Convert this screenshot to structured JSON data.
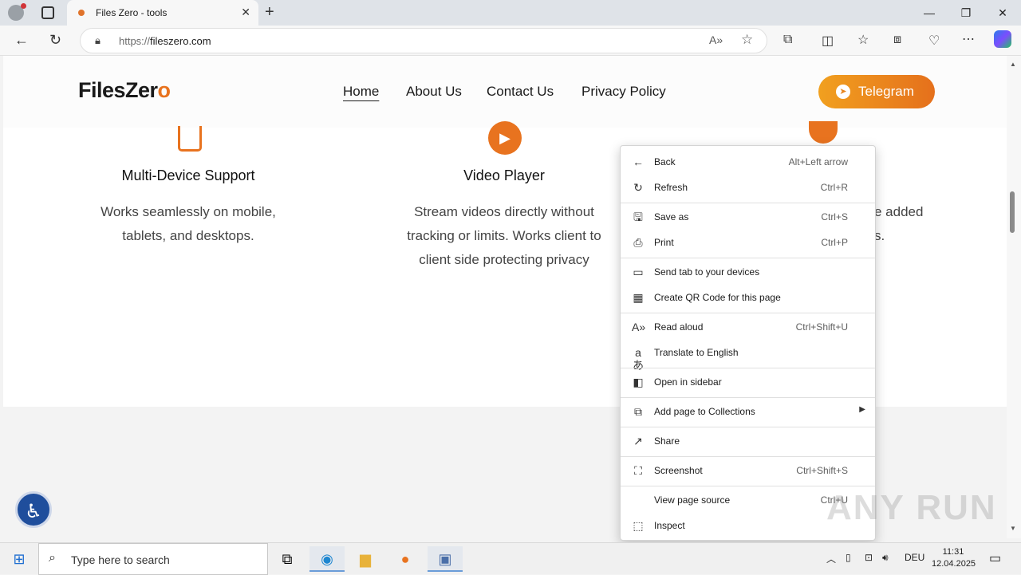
{
  "browser": {
    "tab_title": "Files Zero - tools",
    "url_prefix": "https://",
    "url_host": "fileszero.com"
  },
  "site": {
    "logo_main": "FilesZer",
    "logo_end": "o",
    "nav": [
      "Home",
      "About Us",
      "Contact Us",
      "Privacy Policy"
    ],
    "telegram_label": "Telegram"
  },
  "features": [
    {
      "title": "Multi-Device Support",
      "desc1": "Works seamlessly on mobile,",
      "desc2": "tablets, and desktops.",
      "desc3": ""
    },
    {
      "title": "Video Player",
      "desc1": "Stream videos directly without",
      "desc2": "tracking or limits. Works client to",
      "desc3": "client side protecting privacy"
    },
    {
      "title": "",
      "desc1": "e added",
      "desc2": "s.",
      "desc3": ""
    }
  ],
  "context_menu": {
    "items": [
      {
        "label": "Back",
        "shortcut": "Alt+Left arrow",
        "icon": "back-arrow-icon"
      },
      {
        "label": "Refresh",
        "shortcut": "Ctrl+R",
        "icon": "refresh-icon"
      },
      {
        "label": "Save as",
        "shortcut": "Ctrl+S",
        "icon": "save-icon"
      },
      {
        "label": "Print",
        "shortcut": "Ctrl+P",
        "icon": "print-icon"
      },
      {
        "label": "Send tab to your devices",
        "shortcut": "",
        "icon": "devices-icon"
      },
      {
        "label": "Create QR Code for this page",
        "shortcut": "",
        "icon": "qr-code-icon"
      },
      {
        "label": "Read aloud",
        "shortcut": "Ctrl+Shift+U",
        "icon": "read-aloud-icon"
      },
      {
        "label": "Translate to English",
        "shortcut": "",
        "icon": "translate-icon"
      },
      {
        "label": "Open in sidebar",
        "shortcut": "",
        "icon": "sidebar-icon"
      },
      {
        "label": "Add page to Collections",
        "shortcut": "",
        "icon": "collections-icon"
      },
      {
        "label": "Share",
        "shortcut": "",
        "icon": "share-icon"
      },
      {
        "label": "Screenshot",
        "shortcut": "Ctrl+Shift+S",
        "icon": "screenshot-icon"
      },
      {
        "label": "View page source",
        "shortcut": "Ctrl+U",
        "icon": ""
      },
      {
        "label": "Inspect",
        "shortcut": "",
        "icon": "inspect-icon"
      }
    ]
  },
  "watermark": "ANY RUN",
  "taskbar": {
    "search_placeholder": "Type here to search",
    "language": "DEU",
    "time": "11:31",
    "date": "12.04.2025"
  },
  "colors": {
    "accent_orange": "#e8731f",
    "telegram_start": "#f1a01f",
    "telegram_end": "#e5701c",
    "accessibility_blue": "#1f4e9c"
  }
}
